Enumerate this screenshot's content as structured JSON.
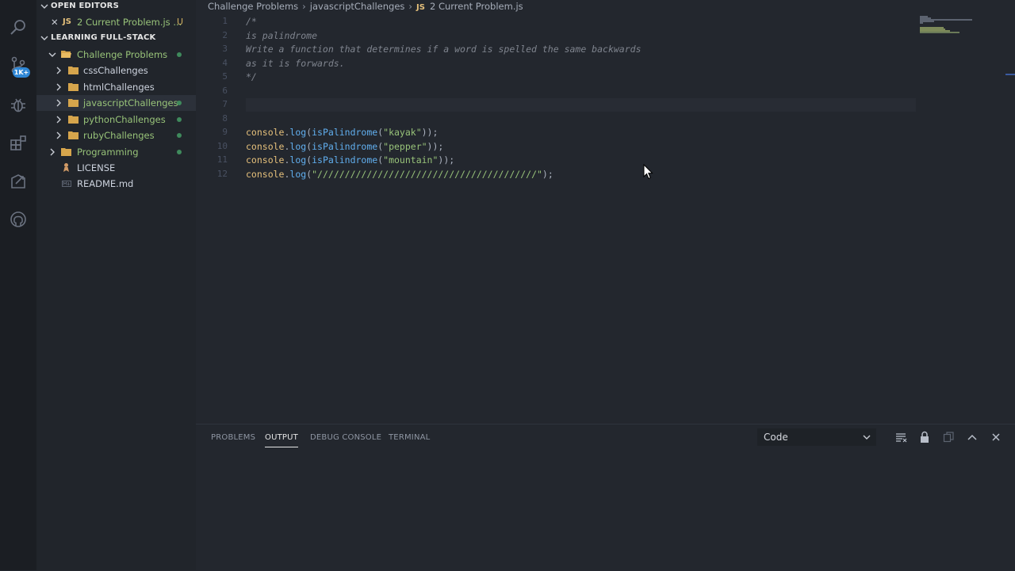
{
  "activity_bar": {
    "items": [
      {
        "icon": "search-icon"
      },
      {
        "icon": "source-control-icon",
        "badge": "1K+"
      },
      {
        "icon": "debug-icon"
      },
      {
        "icon": "extensions-icon"
      },
      {
        "icon": "remote-explorer-icon"
      },
      {
        "icon": "github-icon"
      }
    ]
  },
  "sidebar": {
    "open_editors": {
      "title": "OPEN EDITORS",
      "items": [
        {
          "prefix": "JS",
          "label": "2 Current Problem.js ...",
          "status": "U"
        }
      ]
    },
    "workspace": {
      "title": "LEARNING FULL-STACK",
      "tree": [
        {
          "label": "Challenge Problems",
          "depth": 0,
          "expanded": true
        },
        {
          "label": "cssChallenges",
          "depth": 1
        },
        {
          "label": "htmlChallenges",
          "depth": 1
        },
        {
          "label": "javascriptChallenges",
          "depth": 1
        },
        {
          "label": "pythonChallenges",
          "depth": 1
        },
        {
          "label": "rubyChallenges",
          "depth": 1
        },
        {
          "label": "Programming",
          "depth": 0
        },
        {
          "label": "LICENSE",
          "depth": 0
        },
        {
          "label": "README.md",
          "depth": 0
        }
      ]
    }
  },
  "breadcrumb": {
    "items": [
      "Challenge Problems",
      "javascriptChallenges"
    ],
    "file_prefix": "JS",
    "file": "2 Current Problem.js"
  },
  "editor": {
    "lines": [
      {
        "no": "1",
        "text": "/*"
      },
      {
        "no": "2",
        "text": "is palindrome"
      },
      {
        "no": "3",
        "text": "Write a function that determines if a word is spelled the same backwards"
      },
      {
        "no": "4",
        "text": "as it is forwards."
      },
      {
        "no": "5",
        "text": "*/"
      },
      {
        "no": "6",
        "text": ""
      },
      {
        "no": "7",
        "text": ""
      },
      {
        "no": "8",
        "text": ""
      },
      {
        "no": "9",
        "obj": "console",
        "dot": ".",
        "method": "log",
        "open": "(",
        "fn": "isPalindrome",
        "open2": "(",
        "str": "\"kayak\"",
        "close": "));"
      },
      {
        "no": "10",
        "obj": "console",
        "dot": ".",
        "method": "log",
        "open": "(",
        "fn": "isPalindrome",
        "open2": "(",
        "str": "\"pepper\"",
        "close": "));"
      },
      {
        "no": "11",
        "obj": "console",
        "dot": ".",
        "method": "log",
        "open": "(",
        "fn": "isPalindrome",
        "open2": "(",
        "str": "\"mountain\"",
        "close": "));"
      },
      {
        "no": "12",
        "obj": "console",
        "dot": ".",
        "method": "log",
        "open": "(",
        "str": "\"////////////////////////////////////////\"",
        "close": ");"
      }
    ]
  },
  "panel": {
    "tabs": [
      "PROBLEMS",
      "OUTPUT",
      "DEBUG CONSOLE",
      "TERMINAL"
    ],
    "active_tab": "OUTPUT",
    "output_channel": "Code",
    "icons": [
      "clear-output-icon",
      "lock-scroll-icon",
      "open-log-icon",
      "maximize-panel-icon",
      "close-panel-icon"
    ]
  },
  "colors": {
    "background": "#23272e",
    "sidebar": "#21252b",
    "activity_bar": "#1b1e23",
    "accent": "#2f87d6",
    "string": "#98c379",
    "function": "#61afef",
    "object": "#e5c07b",
    "comment": "#7f848e"
  }
}
